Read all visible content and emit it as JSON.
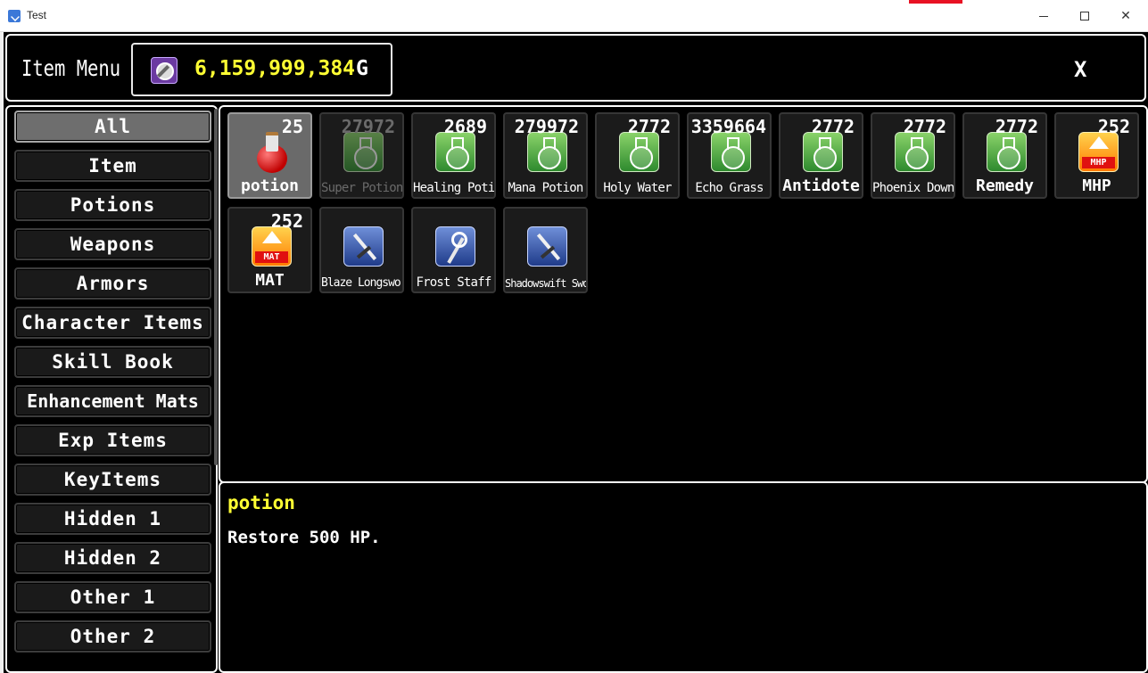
{
  "window": {
    "title": "Test"
  },
  "header": {
    "title": "Item Menu",
    "gold_amount": "6,159,999,384",
    "gold_unit": "G",
    "close_label": "X",
    "gold_color": "#ffff33"
  },
  "sidebar": {
    "categories": [
      "All",
      "Item",
      "Potions",
      "Weapons",
      "Armors",
      "Character Items",
      "Skill Book",
      "Enhancement Mats",
      "Exp Items",
      "KeyItems",
      "Hidden 1",
      "Hidden 2",
      "Other 1",
      "Other 2"
    ],
    "active": "All"
  },
  "items": [
    {
      "name": "potion",
      "count": "25",
      "icon": "red-potion-icon"
    },
    {
      "name": "Super Potion",
      "count": "27972",
      "icon": "green-flask-icon"
    },
    {
      "name": "Healing Potion",
      "count": "2689",
      "icon": "green-flask-icon"
    },
    {
      "name": "Mana Potion",
      "count": "279972",
      "icon": "green-flask-icon"
    },
    {
      "name": "Holy Water",
      "count": "2772",
      "icon": "green-flask-icon"
    },
    {
      "name": "Echo Grass",
      "count": "3359664",
      "icon": "green-flask-icon"
    },
    {
      "name": "Antidote",
      "count": "2772",
      "icon": "green-flask-icon"
    },
    {
      "name": "Phoenix Down",
      "count": "2772",
      "icon": "green-flask-icon"
    },
    {
      "name": "Remedy",
      "count": "2772",
      "icon": "green-flask-icon"
    },
    {
      "name": "MHP",
      "count": "252",
      "icon": "mhp-up-icon",
      "tag": "MHP"
    },
    {
      "name": "MAT",
      "count": "252",
      "icon": "mat-up-icon",
      "tag": "MAT"
    },
    {
      "name": "Blaze Longsword",
      "count": "",
      "icon": "sword-icon"
    },
    {
      "name": "Frost Staff",
      "count": "",
      "icon": "staff-icon"
    },
    {
      "name": "Shadowswift Sword",
      "count": "",
      "icon": "sword-icon"
    }
  ],
  "selected_item": {
    "name": "potion",
    "description": "Restore 500 HP."
  }
}
